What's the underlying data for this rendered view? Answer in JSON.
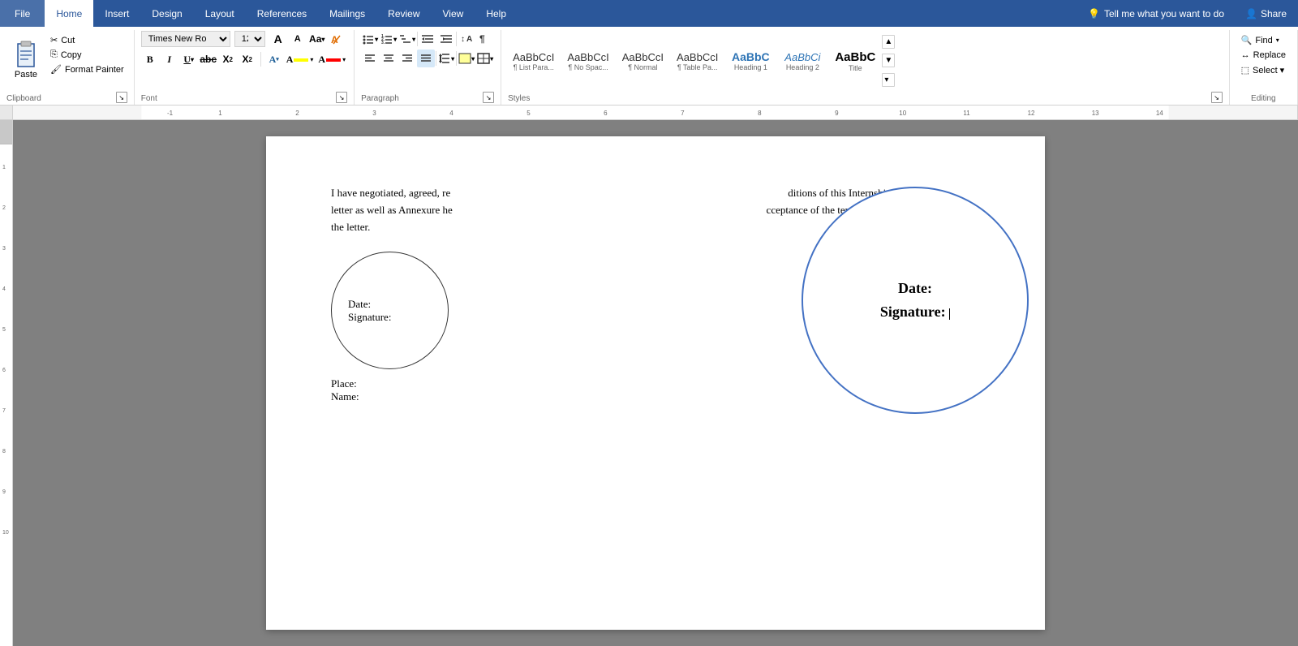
{
  "tabs": {
    "file": "File",
    "home": "Home",
    "insert": "Insert",
    "design": "Design",
    "layout": "Layout",
    "references": "References",
    "mailings": "Mailings",
    "review": "Review",
    "view": "View",
    "help": "Help",
    "tell_me": "Tell me what you want to do",
    "share": "Share"
  },
  "ribbon": {
    "clipboard": {
      "label": "Clipboard",
      "paste": "Paste",
      "cut": "Cut",
      "copy": "Copy",
      "format_painter": "Format Painter"
    },
    "font": {
      "label": "Font",
      "font_name": "Times New Ro",
      "font_size": "12",
      "grow": "A",
      "shrink": "A",
      "case": "Aa",
      "clear": "✕",
      "bold": "B",
      "italic": "I",
      "underline": "U",
      "strikethrough": "abc",
      "subscript": "X",
      "superscript": "X",
      "text_color": "A",
      "highlight": "A"
    },
    "paragraph": {
      "label": "Paragraph"
    },
    "styles": {
      "label": "Styles",
      "items": [
        {
          "label": "¶ List Para...",
          "preview": "AaBbCcI",
          "style": "normal"
        },
        {
          "label": "¶ No Spac...",
          "preview": "AaBbCcI",
          "style": "normal"
        },
        {
          "label": "¶ Normal",
          "preview": "AaBbCcI",
          "style": "normal"
        },
        {
          "label": "¶ Table Pa...",
          "preview": "AaBbCcI",
          "style": "normal"
        },
        {
          "label": "Heading 1",
          "preview": "AaBbC",
          "style": "heading1"
        },
        {
          "label": "Heading 2",
          "preview": "AaBbCi",
          "style": "heading2"
        },
        {
          "label": "Title",
          "preview": "AaBbC",
          "style": "title"
        }
      ]
    },
    "editing": {
      "label": "Editing",
      "find": "Find",
      "replace": "Replace",
      "select": "Select ▾"
    }
  },
  "document": {
    "body_text": "I have negotiated, agreed, re                                                                                  ditions of this Internship letter as well as Annexure he                                                                    cceptance of the terms of the letter.",
    "small_circle": {
      "date": "Date:",
      "signature": "Signature:"
    },
    "large_circle": {
      "date": "Date:",
      "signature": "Signature: |"
    },
    "below_circle": {
      "place": "Place:",
      "name": "Name:"
    }
  }
}
